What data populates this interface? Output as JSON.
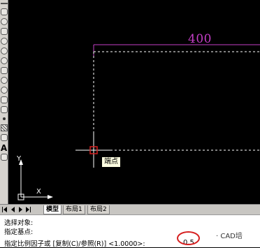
{
  "canvas": {
    "dimension_text": "400",
    "tooltip": "端点"
  },
  "ucs": {
    "y_label": "Y",
    "x_label": "X"
  },
  "tabs": [
    {
      "label": "模型",
      "active": true
    },
    {
      "label": "布局1",
      "active": false
    },
    {
      "label": "布局2",
      "active": false
    }
  ],
  "command": {
    "line1": "选择对象:",
    "line2": "指定基点:",
    "line3": "指定比例因子或 [复制(C)/参照(R)] <1.0000>:",
    "input_value": "0.5"
  },
  "watermark": "· CAD培",
  "colors": {
    "dimension": "#c43ec6",
    "geometry": "#ffffff",
    "highlight": "#d62020"
  },
  "toolbar_tools": [
    "line-icon",
    "polyline-icon",
    "polygon-icon",
    "rectangle-icon",
    "arc-icon",
    "circle-icon",
    "revcloud-icon",
    "spline-icon",
    "ellipse-icon",
    "ellipse-arc-icon",
    "insert-block-icon",
    "make-block-icon",
    "point-icon",
    "hatch-icon",
    "gradient-icon",
    "region-icon",
    "table-icon",
    "mtext-icon"
  ]
}
